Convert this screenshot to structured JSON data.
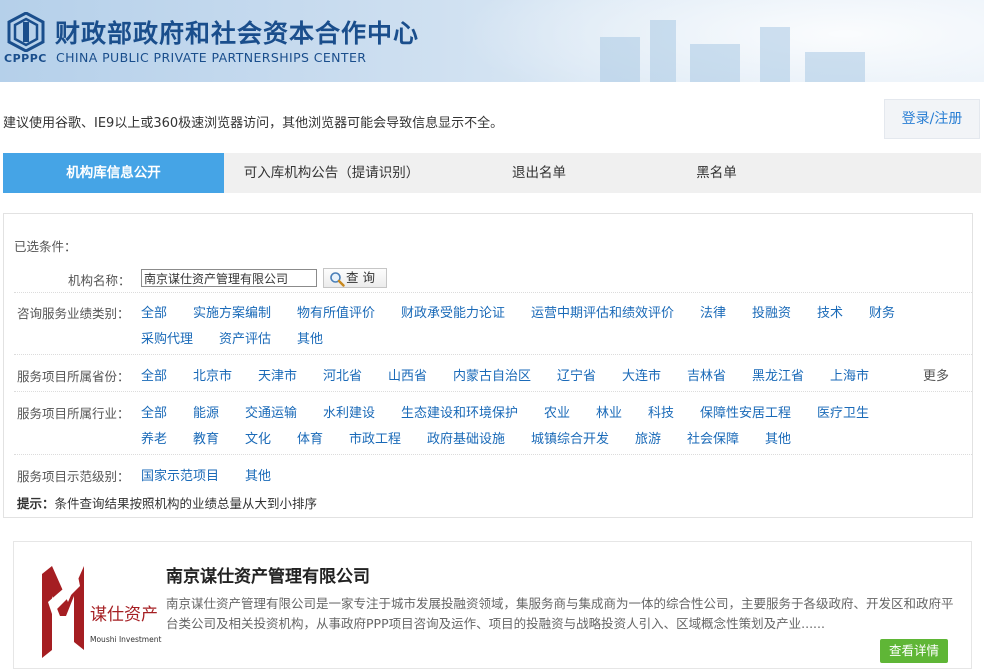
{
  "header": {
    "logo_text": "CPPPC",
    "title_cn": "财政部政府和社会资本合作中心",
    "title_en": "CHINA PUBLIC PRIVATE PARTNERSHIPS CENTER",
    "brand_color": "#1a4e8c"
  },
  "notice": {
    "text": "建议使用谷歌、IE9以上或360极速浏览器访问，其他浏览器可能会导致信息显示不全。",
    "login_label": "登录/注册"
  },
  "tabs": [
    {
      "label": "机构库信息公开",
      "active": true
    },
    {
      "label": "可入库机构公告（提请识别）",
      "active": false
    },
    {
      "label": "退出名单",
      "active": false
    },
    {
      "label": "黑名单",
      "active": false
    }
  ],
  "filter": {
    "selected_label": "已选条件：",
    "name_label": "机构名称：",
    "name_value": "南京谋仕资产管理有限公司",
    "search_label": "查 询",
    "category_label": "咨询服务业绩类别：",
    "category_options": [
      "全部",
      "实施方案编制",
      "物有所值评价",
      "财政承受能力论证",
      "运营中期评估和绩效评价",
      "法律",
      "投融资",
      "技术",
      "财务",
      "采购代理",
      "资产评估",
      "其他"
    ],
    "province_label": "服务项目所属省份：",
    "province_options": [
      "全部",
      "北京市",
      "天津市",
      "河北省",
      "山西省",
      "内蒙古自治区",
      "辽宁省",
      "大连市",
      "吉林省",
      "黑龙江省",
      "上海市"
    ],
    "province_more": "更多",
    "industry_label": "服务项目所属行业：",
    "industry_options": [
      "全部",
      "能源",
      "交通运输",
      "水利建设",
      "生态建设和环境保护",
      "农业",
      "林业",
      "科技",
      "保障性安居工程",
      "医疗卫生",
      "养老",
      "教育",
      "文化",
      "体育",
      "市政工程",
      "政府基础设施",
      "城镇综合开发",
      "旅游",
      "社会保障",
      "其他"
    ],
    "demo_label": "服务项目示范级别：",
    "demo_options": [
      "国家示范项目",
      "其他"
    ],
    "hint_prefix": "提示：",
    "hint_text": "条件查询结果按照机构的业绩总量从大到小排序"
  },
  "result": {
    "company_name": "南京谋仕资产管理有限公司",
    "description": "南京谋仕资产管理有限公司是一家专注于城市发展投融资领域，集服务商与集成商为一体的综合性公司，主要服务于各级政府、开发区和政府平台类公司及相关投资机构，从事政府PPP项目咨询及运作、项目的投融资与战略投资人引入、区域概念性策划及产业......",
    "logo_cn": "谋仕资产",
    "logo_en": "Moushi Investment",
    "detail_label": "查看详情"
  }
}
